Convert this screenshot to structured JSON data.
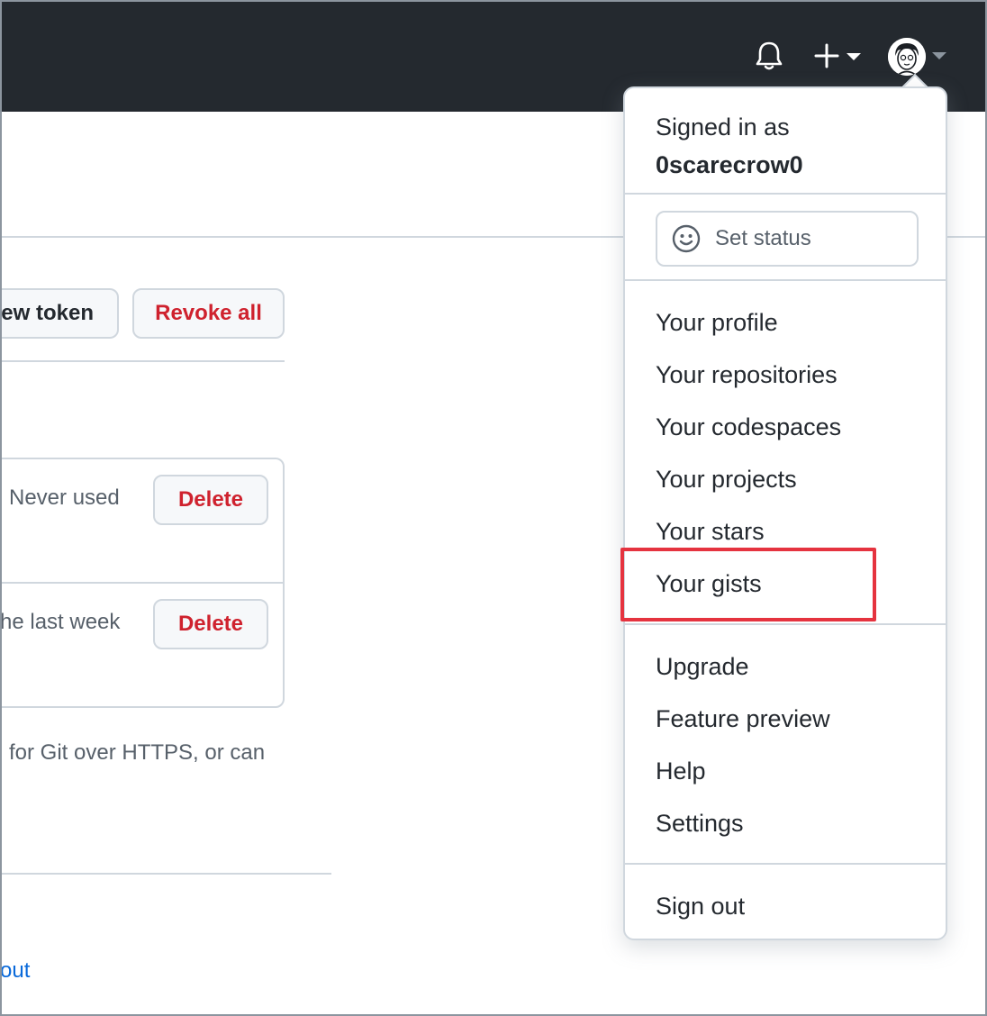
{
  "header": {
    "notifications_icon": "bell-icon",
    "create_icon": "plus-icon",
    "avatar_icon": "avatar"
  },
  "page": {
    "new_token_label": "ew token",
    "revoke_all_label": "Revoke all",
    "tokens": [
      {
        "last_used": "Never used",
        "delete_label": "Delete"
      },
      {
        "last_used": "he last week",
        "delete_label": "Delete"
      }
    ],
    "description_text": "for Git over HTTPS, or can",
    "about_link": "out"
  },
  "menu": {
    "signed_in_label": "Signed in as",
    "username": "0scarecrow0",
    "set_status_label": "Set status",
    "items_group1": [
      "Your profile",
      "Your repositories",
      "Your codespaces",
      "Your projects",
      "Your stars",
      "Your gists"
    ],
    "items_group2": [
      "Upgrade",
      "Feature preview",
      "Help",
      "Settings"
    ],
    "sign_out_label": "Sign out"
  },
  "annotation": {
    "highlight_color": "#e5333f",
    "highlighted_item": "Your gists"
  },
  "colors": {
    "header_bg": "#24292f",
    "danger": "#cf222e",
    "link": "#0969da"
  }
}
